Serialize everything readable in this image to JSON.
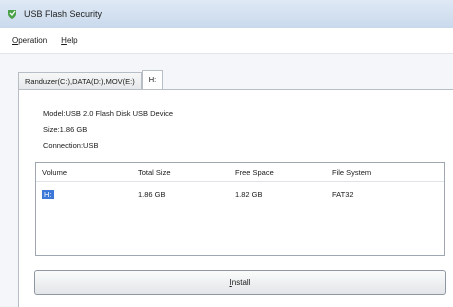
{
  "window": {
    "title": "USB Flash Security"
  },
  "menu": {
    "items": [
      {
        "first": "O",
        "rest": "peration"
      },
      {
        "first": "H",
        "rest": "elp"
      }
    ]
  },
  "tabs": [
    {
      "label": "Randuzer(C:),DATA(D:),MOV(E:)"
    },
    {
      "label": "H:"
    }
  ],
  "info": {
    "model": "Model:USB 2.0 Flash Disk USB Device",
    "size": "Size:1.86 GB",
    "connection": "Connection:USB"
  },
  "listview": {
    "headers": [
      "Volume",
      "Total Size",
      "Free Space",
      "File System"
    ],
    "rows": [
      {
        "volume": "H:",
        "total": "1.86 GB",
        "free": "1.82 GB",
        "fs": "FAT32"
      }
    ]
  },
  "buttons": {
    "install": {
      "first": "I",
      "rest": "nstall"
    }
  },
  "colors": {
    "selection": "#3b78d8",
    "icon": "#4aa14a"
  }
}
